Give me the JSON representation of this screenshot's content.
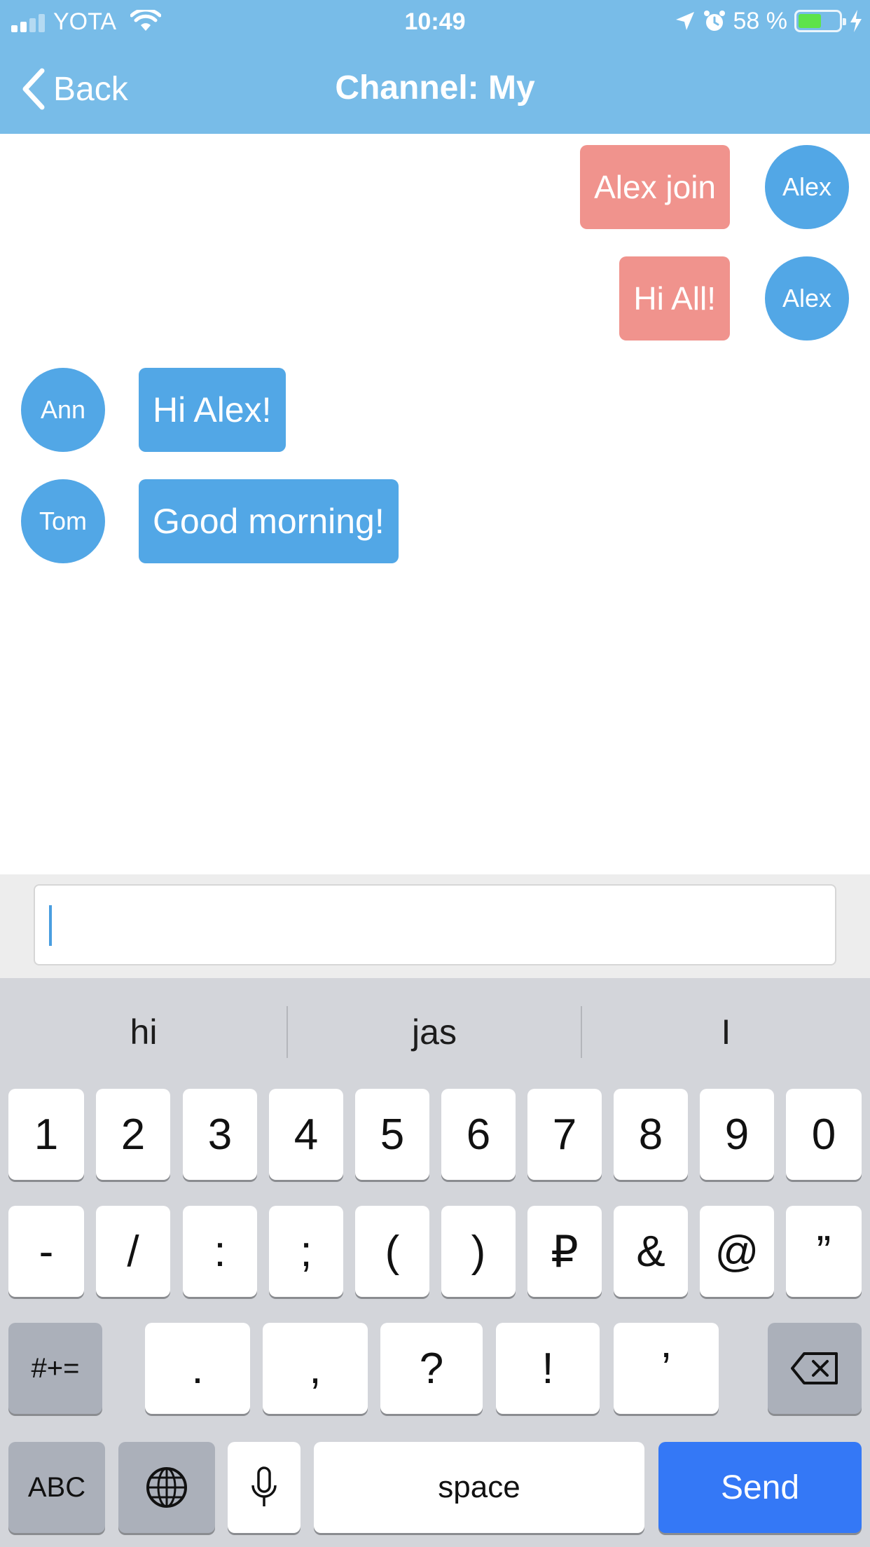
{
  "status_bar": {
    "carrier": "YOTA",
    "time": "10:49",
    "battery": "58 %",
    "battery_level": 0.58
  },
  "nav": {
    "back_label": "Back",
    "title": "Channel: My"
  },
  "messages": [
    {
      "author": "Alex",
      "text": "Alex join",
      "mine": true
    },
    {
      "author": "Alex",
      "text": "Hi All!",
      "mine": true
    },
    {
      "author": "Ann",
      "text": "Hi Alex!",
      "mine": false
    },
    {
      "author": "Tom",
      "text": "Good morning!",
      "mine": false
    }
  ],
  "composer": {
    "value": ""
  },
  "keyboard": {
    "suggestions": [
      "hi",
      "jas",
      "I"
    ],
    "row1": [
      "1",
      "2",
      "3",
      "4",
      "5",
      "6",
      "7",
      "8",
      "9",
      "0"
    ],
    "row2": [
      "-",
      "/",
      ":",
      ";",
      "(",
      ")",
      "₽",
      "&",
      "@",
      "”"
    ],
    "row3": [
      ".",
      ",",
      "?",
      "!",
      "’"
    ],
    "symbols_label": "#+=",
    "abc_label": "ABC",
    "space_label": "space",
    "send_label": "Send"
  },
  "colors": {
    "header": "#78bce8",
    "mine_bubble": "#f0938d",
    "their_bubble": "#52a7e6",
    "send_key": "#3478f6"
  }
}
